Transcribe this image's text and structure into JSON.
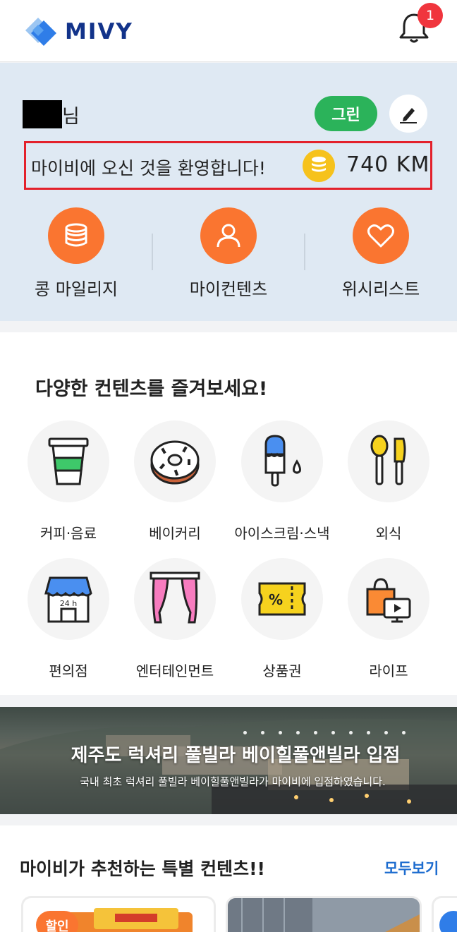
{
  "header": {
    "brand": "MIVY",
    "notification_count": "1"
  },
  "profile": {
    "name_suffix": "님",
    "grade": "그린",
    "welcome": "마이비에 오신 것을 환영합니다!",
    "mileage": "740  KM"
  },
  "quick_menu": [
    {
      "label": "콩 마일리지",
      "icon": "coins-icon"
    },
    {
      "label": "마이컨텐츠",
      "icon": "user-icon"
    },
    {
      "label": "위시리스트",
      "icon": "heart-icon"
    }
  ],
  "categories": {
    "title": "다양한 컨텐츠를 즐겨보세요!",
    "items": [
      {
        "label": "커피·음료",
        "icon": "coffee-cup-icon"
      },
      {
        "label": "베이커리",
        "icon": "donut-icon"
      },
      {
        "label": "아이스크림·스낵",
        "icon": "popsicle-icon"
      },
      {
        "label": "외식",
        "icon": "spoon-knife-icon"
      },
      {
        "label": "편의점",
        "icon": "convenience-store-icon"
      },
      {
        "label": "엔터테인먼트",
        "icon": "curtain-icon"
      },
      {
        "label": "상품권",
        "icon": "coupon-icon"
      },
      {
        "label": "라이프",
        "icon": "shopping-video-icon"
      }
    ]
  },
  "banner": {
    "title": "제주도 럭셔리 풀빌라 베이힐풀앤빌라 입점",
    "subtitle": "국내 최초 럭셔리 풀빌라 베이힐풀앤빌라가 마이비에 입점하였습니다."
  },
  "recommended": {
    "title": "마이비가 추천하는 특별 컨텐츠!!",
    "more_label": "모두보기",
    "card_badge": "할인"
  },
  "colors": {
    "brand_navy": "#12338a",
    "accent_orange": "#fa7530",
    "grade_green": "#2bb35a",
    "link_blue": "#1d6ccf",
    "profile_bg": "#dfe9f3"
  }
}
